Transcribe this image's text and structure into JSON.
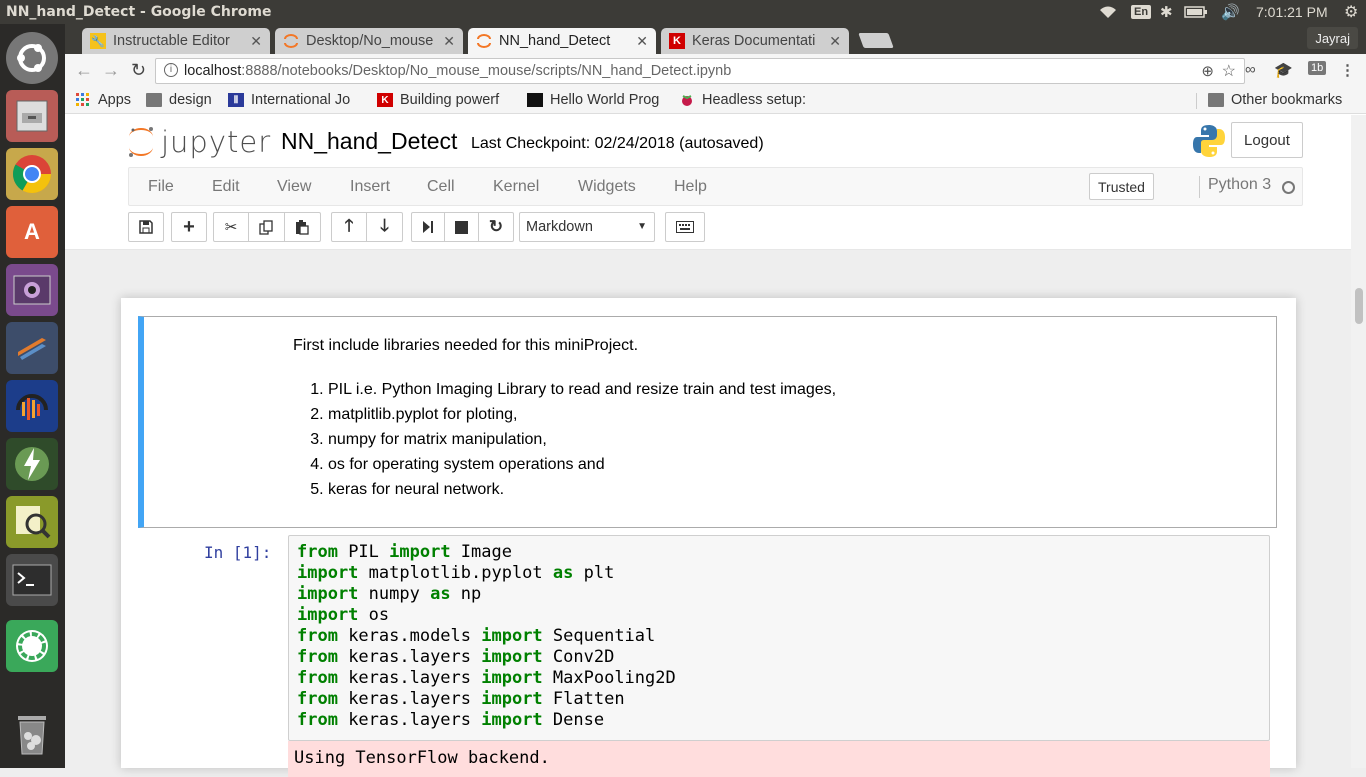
{
  "system": {
    "window_title": "NN_hand_Detect - Google Chrome",
    "keyboard": "En",
    "volume_icon": "volume-icon",
    "time": "7:01:21 PM"
  },
  "launcher": {
    "items": [
      "ubuntu-dash",
      "file-manager",
      "chrome",
      "software-center",
      "screen-recorder",
      "sublime",
      "audacity",
      "app-launcher",
      "image-viewer",
      "terminal",
      "anaconda",
      "trash"
    ]
  },
  "tabs": [
    {
      "title": "Instructable Editor",
      "favicon": "instructables-icon"
    },
    {
      "title": "Desktop/No_mouse",
      "favicon": "jupyter-icon"
    },
    {
      "title": "NN_hand_Detect",
      "favicon": "jupyter-icon",
      "active": true
    },
    {
      "title": "Keras Documentati",
      "favicon": "keras-icon"
    }
  ],
  "profile": "Jayraj",
  "url": {
    "host": "localhost",
    "path": ":8888/notebooks/Desktop/No_mouse_mouse/scripts/NN_hand_Detect.ipynb"
  },
  "bookmarks": {
    "apps": "Apps",
    "items": [
      {
        "label": "design",
        "icon": "folder-icon"
      },
      {
        "label": "International Jo",
        "icon": "ij-icon"
      },
      {
        "label": "Building powerf",
        "icon": "keras-icon"
      },
      {
        "label": "Hello World Prog",
        "icon": "site-icon"
      },
      {
        "label": "Headless setup:",
        "icon": "raspberry-icon"
      }
    ],
    "other": "Other bookmarks"
  },
  "jupyter": {
    "logo_text": "jupyter",
    "notebook_name": "NN_hand_Detect",
    "checkpoint": "Last Checkpoint: 02/24/2018 (autosaved)",
    "logout": "Logout",
    "menu": [
      "File",
      "Edit",
      "View",
      "Insert",
      "Cell",
      "Kernel",
      "Widgets",
      "Help"
    ],
    "trusted": "Trusted",
    "kernel": "Python 3",
    "cell_type": "Markdown"
  },
  "markdown_cell": {
    "intro": "First include libraries needed for this miniProject.",
    "items": [
      "PIL i.e. Python Imaging Library to read and resize train and test images,",
      "matplitlib.pyplot for ploting,",
      "numpy for matrix manipulation,",
      "os for operating system operations and",
      "keras for neural network."
    ]
  },
  "code_cell": {
    "prompt": "In [1]:",
    "lines": [
      [
        "from",
        " PIL ",
        "import",
        " Image"
      ],
      [
        "import",
        " matplotlib.pyplot ",
        "as",
        " plt"
      ],
      [
        "import",
        " numpy ",
        "as",
        " np"
      ],
      [
        "import",
        " os",
        "",
        ""
      ],
      [
        "from",
        " keras.models ",
        "import",
        " Sequential"
      ],
      [
        "from",
        " keras.layers ",
        "import",
        " Conv2D"
      ],
      [
        "from",
        " keras.layers ",
        "import",
        " MaxPooling2D"
      ],
      [
        "from",
        " keras.layers ",
        "import",
        " Flatten"
      ],
      [
        "from",
        " keras.layers ",
        "import",
        " Dense"
      ]
    ],
    "output": "Using TensorFlow backend."
  }
}
